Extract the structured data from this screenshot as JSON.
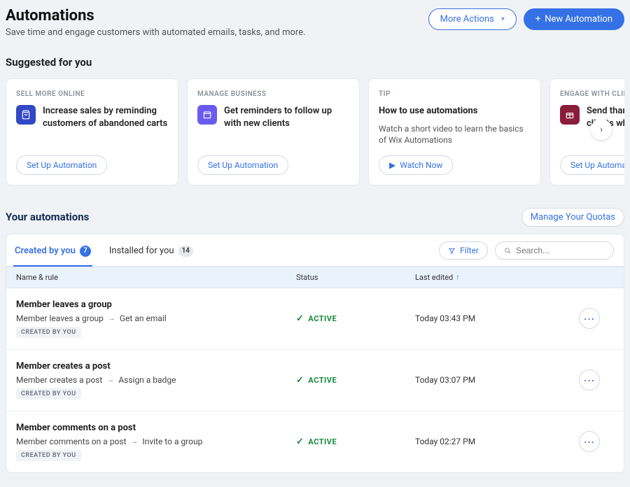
{
  "header": {
    "title": "Automations",
    "subtitle": "Save time and engage customers with automated emails, tasks, and more.",
    "more_actions": "More Actions",
    "new_automation": "New Automation"
  },
  "suggested": {
    "heading": "Suggested for you",
    "cards": [
      {
        "eyebrow": "SELL MORE ONLINE",
        "title": "Increase sales by reminding customers of abandoned carts",
        "cta": "Set Up Automation",
        "icon": "bag"
      },
      {
        "eyebrow": "MANAGE BUSINESS",
        "title": "Get reminders to follow up with new clients",
        "cta": "Set Up Automation",
        "icon": "calendar"
      },
      {
        "eyebrow": "TIP",
        "title": "How to use automations",
        "subtext": "Watch a short video to learn the basics of Wix Automations",
        "cta": "Watch Now",
        "icon": "play"
      },
      {
        "eyebrow": "ENGAGE WITH CLIENTS",
        "title": "Send thank you emails to clients who submit a form",
        "cta": "Set Up Automation",
        "icon": "gift"
      }
    ]
  },
  "automations": {
    "heading": "Your automations",
    "manage_quotas": "Manage Your Quotas",
    "tabs": {
      "created": {
        "label": "Created by you",
        "count": "7"
      },
      "installed": {
        "label": "Installed for you",
        "count": "14"
      }
    },
    "controls": {
      "filter": "Filter",
      "search_placeholder": "Search..."
    },
    "columns": {
      "name": "Name & rule",
      "status": "Status",
      "last": "Last edited"
    },
    "rows": [
      {
        "title": "Member leaves a group",
        "trigger": "Member leaves a group",
        "action": "Get an email",
        "status": "ACTIVE",
        "last": "Today 03:43 PM",
        "tag": "CREATED BY YOU"
      },
      {
        "title": "Member creates a post",
        "trigger": "Member creates a post",
        "action": "Assign a badge",
        "status": "ACTIVE",
        "last": "Today 03:07 PM",
        "tag": "CREATED BY YOU"
      },
      {
        "title": "Member comments on a post",
        "trigger": "Member comments on a post",
        "action": "Invite to a group",
        "status": "ACTIVE",
        "last": "Today 02:27 PM",
        "tag": "CREATED BY YOU"
      }
    ]
  }
}
